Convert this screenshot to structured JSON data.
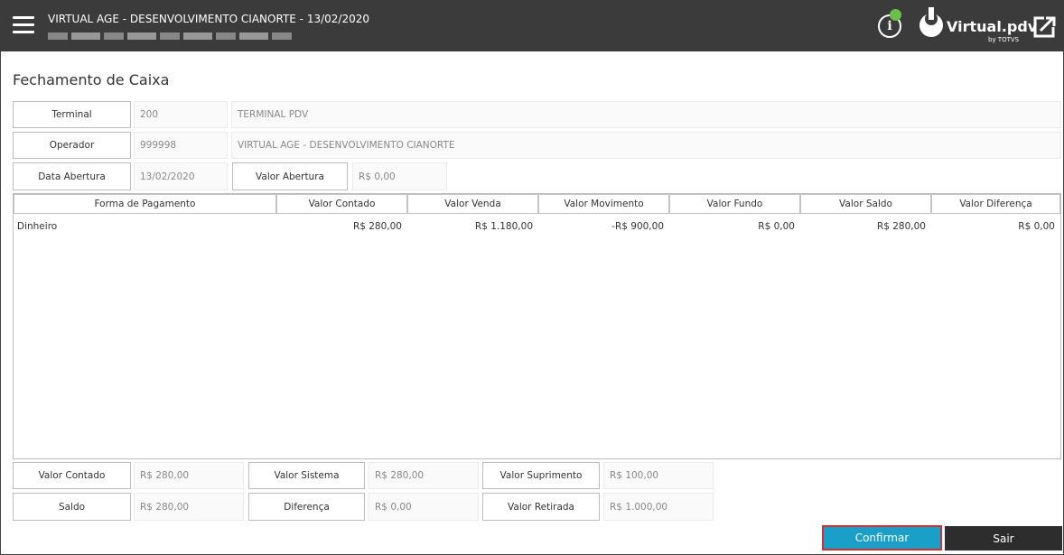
{
  "header": {
    "title": "VIRTUAL AGE - DESENVOLVIMENTO CIANORTE - 13/02/2020",
    "logo_text": "Virtual.pdv",
    "logo_sub": "by TOTVS"
  },
  "page": {
    "title": "Fechamento de Caixa"
  },
  "fields": {
    "terminal": {
      "label": "Terminal",
      "code": "200",
      "name": "TERMINAL PDV"
    },
    "operador": {
      "label": "Operador",
      "code": "999998",
      "name": "VIRTUAL AGE - DESENVOLVIMENTO CIANORTE"
    },
    "data_abertura": {
      "label": "Data Abertura",
      "value": "13/02/2020"
    },
    "valor_abertura": {
      "label": "Valor Abertura",
      "value": "R$ 0,00"
    }
  },
  "table": {
    "columns": [
      "Forma de Pagamento",
      "Valor Contado",
      "Valor Venda",
      "Valor Movimento",
      "Valor Fundo",
      "Valor Saldo",
      "Valor Diferença"
    ],
    "rows": [
      [
        "Dinheiro",
        "R$ 280,00",
        "R$ 1.180,00",
        "-R$ 900,00",
        "R$ 0,00",
        "R$ 280,00",
        "R$ 0,00"
      ]
    ]
  },
  "summary": {
    "valor_contado": {
      "label": "Valor Contado",
      "value": "R$ 280,00"
    },
    "valor_sistema": {
      "label": "Valor Sistema",
      "value": "R$ 280,00"
    },
    "valor_suprimento": {
      "label": "Valor Suprimento",
      "value": "R$ 100,00"
    },
    "saldo": {
      "label": "Saldo",
      "value": "R$ 280,00"
    },
    "diferenca": {
      "label": "Diferença",
      "value": "R$ 0,00"
    },
    "valor_retirada": {
      "label": "Valor Retirada",
      "value": "R$ 1.000,00"
    }
  },
  "buttons": {
    "confirm": "Confirmar",
    "exit": "Sair"
  },
  "colors": {
    "topbar": "#3b3b3b",
    "confirm": "#1aa0c8",
    "confirm_border": "#d32f2f",
    "exit": "#2d2d2d",
    "status": "#6cc04a"
  }
}
